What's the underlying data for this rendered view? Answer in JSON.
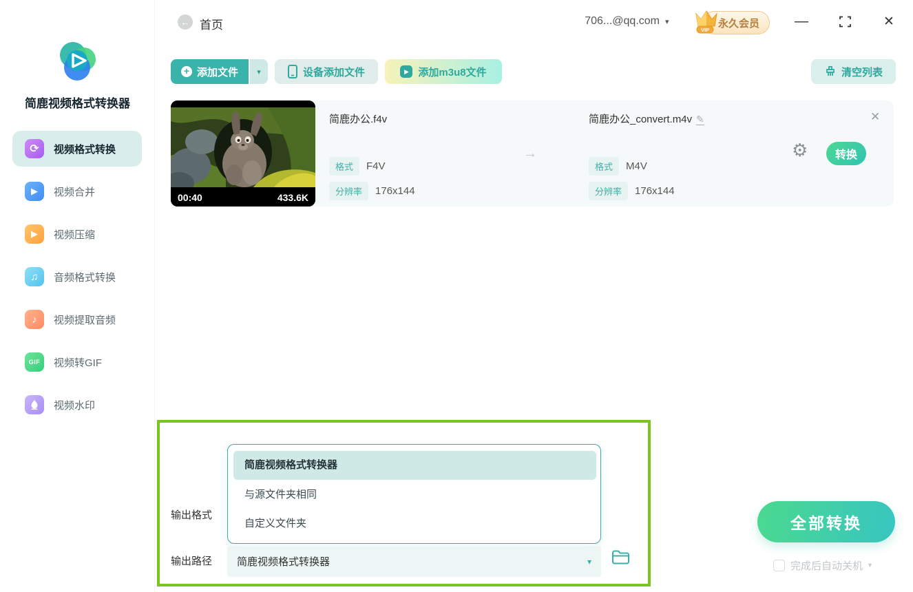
{
  "app": {
    "name": "简鹿视频格式转换器"
  },
  "titlebar": {
    "back_icon": "←",
    "home_label": "首页",
    "account": "706...@qq.com",
    "account_caret": "▾",
    "vip_label": "永久会员",
    "minimize_icon": "—",
    "close_icon": "✕"
  },
  "sidebar": {
    "items": [
      {
        "label": "视频格式转换",
        "glyph": "⟳",
        "active": true
      },
      {
        "label": "视频合并",
        "glyph": "▶",
        "active": false
      },
      {
        "label": "视频压缩",
        "glyph": "▶",
        "active": false
      },
      {
        "label": "音频格式转换",
        "glyph": "♫",
        "active": false
      },
      {
        "label": "视频提取音频",
        "glyph": "♪",
        "active": false
      },
      {
        "label": "视频转GIF",
        "glyph": "GIF",
        "active": false
      },
      {
        "label": "视频水印",
        "glyph": "",
        "active": false
      }
    ]
  },
  "toolbar": {
    "add_file_label": "添加文件",
    "add_file_plus": "+",
    "add_file_caret": "▾",
    "device_add_label": "设备添加文件",
    "m3u8_label": "添加m3u8文件",
    "m3u8_play": "▶",
    "clear_list_label": "清空列表"
  },
  "file_item": {
    "duration": "00:40",
    "size": "433.6K",
    "arrow_icon": "→",
    "gear_icon": "⚙",
    "edit_icon": "✎",
    "close_icon": "✕",
    "convert_label": "转换",
    "source": {
      "name": "简鹿办公.f4v",
      "format_label": "格式",
      "format": "F4V",
      "resolution_label": "分辨率",
      "resolution": "176x144"
    },
    "output": {
      "name": "简鹿办公_convert.m4v",
      "format_label": "格式",
      "format": "M4V",
      "resolution_label": "分辨率",
      "resolution": "176x144"
    }
  },
  "output_section": {
    "format_label": "输出格式",
    "path_label": "输出路径",
    "dropdown_options": [
      "简鹿视频格式转换器",
      "与源文件夹相同",
      "自定义文件夹"
    ],
    "selected_option": "简鹿视频格式转换器",
    "path_value": "简鹿视频格式转换器",
    "path_caret": "▾"
  },
  "actions": {
    "convert_all_label": "全部转换",
    "auto_shutdown_label": "完成后自动关机",
    "auto_shutdown_caret": "▾",
    "auto_shutdown_checked": false
  },
  "colors": {
    "accent_teal": "#35b3aa",
    "accent_light": "#d9efec",
    "convert_gradient_start": "#4ed892",
    "convert_gradient_end": "#2fc3b2",
    "annotation_green": "#7cc420",
    "vip_gold": "#f5b43c",
    "vip_text": "#b5803f"
  }
}
